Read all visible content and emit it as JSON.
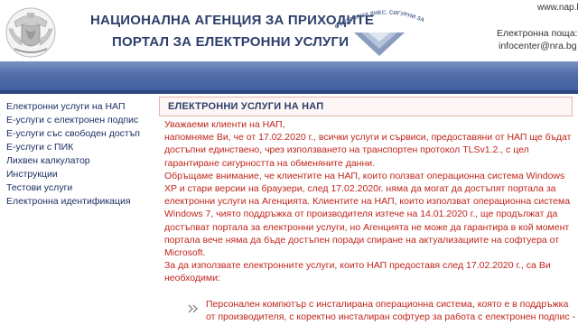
{
  "header": {
    "agency_name": "НАЦИОНАЛНА АГЕНЦИЯ ЗА ПРИХОДИТЕ",
    "portal_name": "ПОРТАЛ ЗА ЕЛЕКТРОННИ УСЛУГИ",
    "slogan": "ОТГОВОРНИ ДНЕС. СИГУРНИ ЗА УТРЕ",
    "site_url": "www.nap.bg",
    "mail_label": "Електронна поща:",
    "mail_value": "infocenter@nra.bg"
  },
  "sidebar": {
    "items": [
      {
        "label": "Електронни услуги на НАП"
      },
      {
        "label": "Е-услуги с електронен подпис"
      },
      {
        "label": "Е-услуги със свободен достъп"
      },
      {
        "label": "Е-услуги с ПИК"
      },
      {
        "label": "Лихвен калкулатор"
      },
      {
        "label": "Инструкции"
      },
      {
        "label": "Тестови услуги"
      },
      {
        "label": "Електронна идентификация"
      }
    ]
  },
  "main": {
    "title": "ЕЛЕКТРОННИ УСЛУГИ НА НАП",
    "paragraphs": [
      "Уважаеми клиенти на НАП,",
      "напомняме Ви, че от 17.02.2020 г., всички услуги и сървиси, предоставяни от НАП ще бъдат достъпни единствено, чрез използването на транспортен протокол TLSv1.2., с цел гарантиране сигурността на обменяните данни.",
      "Обръщаме внимание, че клиентите на НАП, които ползват операционна система Windows XP и стари версии на браузери, след 17.02.2020г. няма да могат да достъпят портала за електронни услуги на Агенцията. Клиентите на НАП, които използват операционна система Windows 7, чиято поддръжка от производителя изтече на 14.01.2020 г., ще продължат да достъпват портала за електронни услуги, но Агенцията не може да гарантира в кой момент портала вече няма да бъде достъпен поради спиране на актуализациите на софтуера от Microsoft.",
      "За да използвате електронните услуги, които НАП предоставя след 17.02.2020 г., са Ви необходими:"
    ],
    "bullets": [
      "Персонален компютър с инсталирана операционна система, която е в поддръжка от производителя, с коректно инсталиран софтуер за работа с електронен подпис -"
    ]
  },
  "colors": {
    "band": "#3f5c9c",
    "text_red": "#c0251b",
    "nav_text": "#1b2f63",
    "title_text": "#2c3f6b"
  }
}
